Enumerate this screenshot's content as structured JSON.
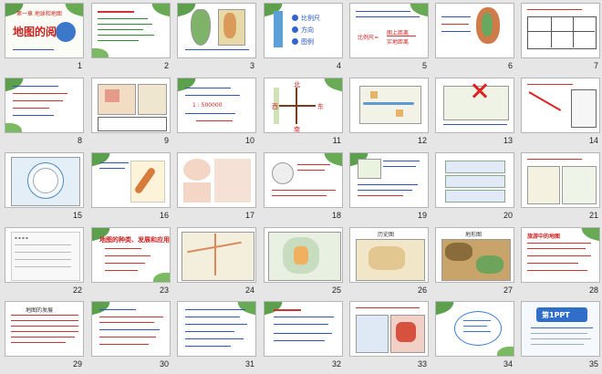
{
  "slides": [
    {
      "number": "1",
      "title": "地图的阅读",
      "subtitle": "第一章 地球和地图"
    },
    {
      "number": "2"
    },
    {
      "number": "3"
    },
    {
      "number": "4",
      "items": [
        "比例尺",
        "方向",
        "图例"
      ]
    },
    {
      "number": "5",
      "items": [
        "图上距离",
        "实地距离"
      ]
    },
    {
      "number": "6"
    },
    {
      "number": "7"
    },
    {
      "number": "8"
    },
    {
      "number": "9"
    },
    {
      "number": "10",
      "ratio": "1 : 500000"
    },
    {
      "number": "11",
      "compass": [
        "北",
        "南",
        "西",
        "东"
      ]
    },
    {
      "number": "12"
    },
    {
      "number": "13"
    },
    {
      "number": "14"
    },
    {
      "number": "15"
    },
    {
      "number": "16"
    },
    {
      "number": "17"
    },
    {
      "number": "18"
    },
    {
      "number": "19"
    },
    {
      "number": "20"
    },
    {
      "number": "21"
    },
    {
      "number": "22"
    },
    {
      "number": "23",
      "title": "地图的种类、发展和应用"
    },
    {
      "number": "24"
    },
    {
      "number": "25"
    },
    {
      "number": "26",
      "title": "历史图"
    },
    {
      "number": "27",
      "title": "地形图"
    },
    {
      "number": "28",
      "title": "旅游中的地图"
    },
    {
      "number": "29",
      "title": "地图的发展"
    },
    {
      "number": "30"
    },
    {
      "number": "31"
    },
    {
      "number": "32"
    },
    {
      "number": "33"
    },
    {
      "number": "34"
    },
    {
      "number": "35",
      "logo": "第1PPT"
    }
  ]
}
